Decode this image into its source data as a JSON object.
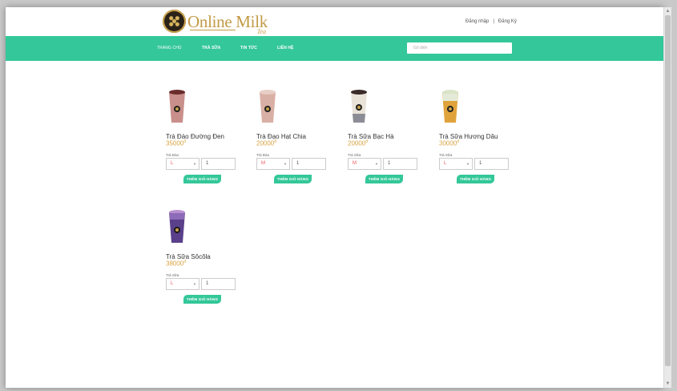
{
  "header": {
    "logo_text": "Online Milk",
    "logo_sub": "Tea",
    "login": "Đăng nhập",
    "separator": "|",
    "register": "Đăng Ký"
  },
  "nav": {
    "items": [
      "TRANG CHỦ",
      "TRÀ SỮA",
      "TIN TỨC",
      "LIÊN HỆ"
    ],
    "search_placeholder": "Gõ điện"
  },
  "products": [
    {
      "name": "Trà Đào Đường Đen",
      "price": "35000",
      "currency": "đ",
      "type": "Trà Đào",
      "size": "L",
      "qty": "1",
      "button": "THÊM GIỎ HÀNG",
      "color": "#c98f8a"
    },
    {
      "name": "Trà Đạo Hạt Chia",
      "price": "20000",
      "currency": "đ",
      "type": "Trà Đào",
      "size": "M",
      "qty": "1",
      "button": "THÊM GIỎ HÀNG",
      "color": "#d9b0a5"
    },
    {
      "name": "Trà Sữa Bạc Hà",
      "price": "20000",
      "currency": "đ",
      "type": "Trà Sữa",
      "size": "M",
      "qty": "1",
      "button": "THÊM GIỎ HÀNG",
      "color": "#e9e2d9"
    },
    {
      "name": "Trà Sữa Hương Dâu",
      "price": "30000",
      "currency": "đ",
      "type": "Trà Sữa",
      "size": "L",
      "qty": "1",
      "button": "THÊM GIỎ HÀNG",
      "color": "#e0a33c"
    },
    {
      "name": "Trà Sữa Sôcôla",
      "price": "38000",
      "currency": "đ",
      "type": "Trà Sữa",
      "size": "L",
      "qty": "1",
      "button": "THÊM GIỎ HÀNG",
      "color": "#5a3f8a"
    }
  ],
  "colors": {
    "accent": "#34c799",
    "price": "#d9a441",
    "logo": "#c29a46"
  }
}
